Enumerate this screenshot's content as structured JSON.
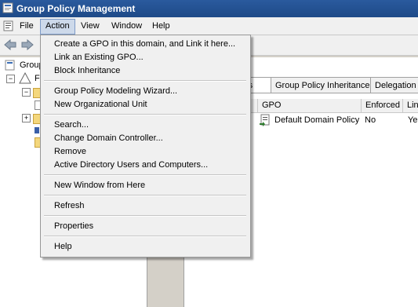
{
  "window": {
    "title": "Group Policy Management"
  },
  "menubar": {
    "items": [
      "File",
      "Action",
      "View",
      "Window",
      "Help"
    ]
  },
  "tree": {
    "root_label": "Group Policy Management",
    "forest_label": "F"
  },
  "tabs": [
    "ects",
    "Group Policy Inheritance",
    "Delegation"
  ],
  "list": {
    "columns": [
      "GPO",
      "Enforced",
      "Lin"
    ],
    "rows": [
      {
        "gpo": "Default Domain Policy",
        "enforced": "No",
        "link": "Ye"
      }
    ]
  },
  "action_menu": {
    "groups": [
      [
        "Create a GPO in this domain, and Link it here...",
        "Link an Existing GPO...",
        "Block Inheritance"
      ],
      [
        "Group Policy Modeling Wizard...",
        "New Organizational Unit"
      ],
      [
        "Search...",
        "Change Domain Controller...",
        "Remove",
        "Active Directory Users and Computers..."
      ],
      [
        "New Window from Here"
      ],
      [
        "Refresh"
      ],
      [
        "Properties"
      ],
      [
        "Help"
      ]
    ]
  }
}
